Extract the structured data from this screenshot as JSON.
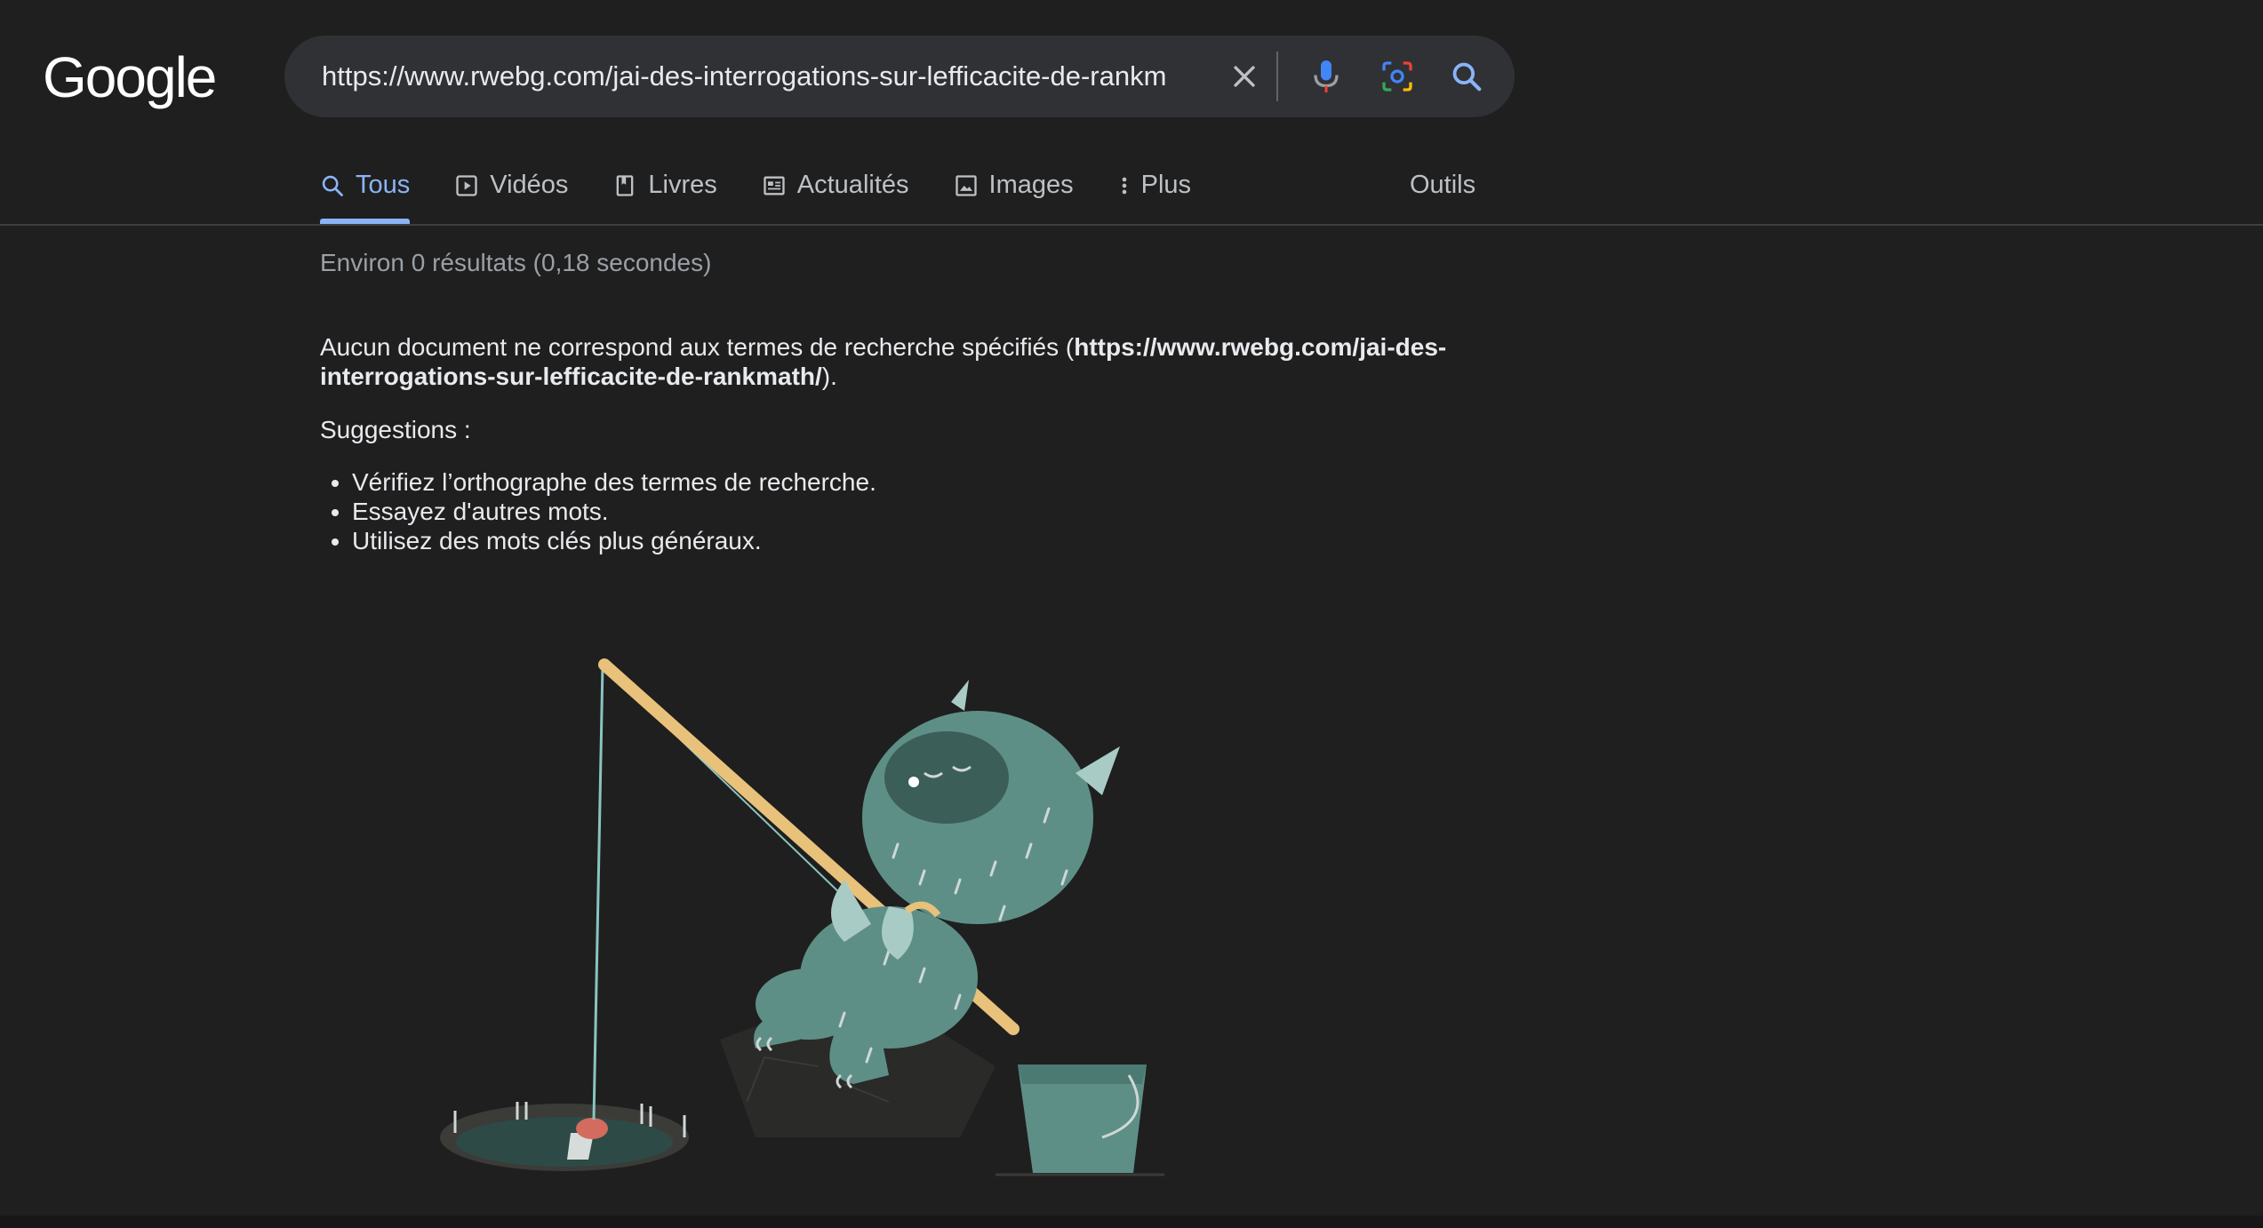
{
  "logo": {
    "text": "Google"
  },
  "search": {
    "value": "https://www.rwebg.com/jai-des-interrogations-sur-lefficacite-de-rankm",
    "full_query": "https://www.rwebg.com/jai-des-interrogations-sur-lefficacite-de-rankmath/"
  },
  "tabs": [
    {
      "label": "Tous",
      "icon": "search-icon",
      "active": true
    },
    {
      "label": "Vidéos",
      "icon": "play-icon"
    },
    {
      "label": "Livres",
      "icon": "book-icon"
    },
    {
      "label": "Actualités",
      "icon": "news-icon"
    },
    {
      "label": "Images",
      "icon": "image-icon"
    },
    {
      "label": "Plus",
      "icon": "more-vert-icon"
    }
  ],
  "tools_label": "Outils",
  "results": {
    "stats": "Environ 0 résultats (0,18 secondes)",
    "no_match_prefix": "Aucun document ne correspond aux termes de recherche spécifiés (",
    "no_match_query": "https://www.rwebg.com/jai-des-interrogations-sur-lefficacite-de-rankmath/",
    "no_match_suffix": ").",
    "suggestions_title": "Suggestions :",
    "suggestions": [
      "Vérifiez l’orthographe des termes de recherche.",
      "Essayez d'autres mots.",
      "Utilisez des mots clés plus généraux."
    ]
  },
  "colors": {
    "background": "#1f1f1f",
    "accent": "#8ab4f8",
    "illustration_teal": "#5e8f86",
    "rod": "#e8c27a"
  }
}
